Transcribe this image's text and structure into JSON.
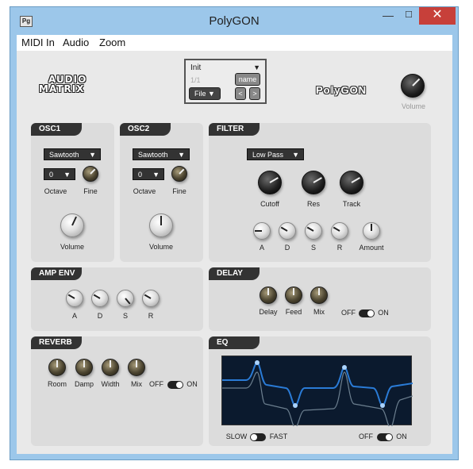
{
  "window": {
    "title": "PolyGON",
    "icon_label": "Pg",
    "minimize": "—",
    "maximize": "☐",
    "close": "✕"
  },
  "menu": {
    "items": [
      "MIDI In",
      "Audio",
      "Zoom"
    ]
  },
  "header": {
    "logo_line1": "AUDIO",
    "logo_line2": "MATRIX",
    "product_logo": "PolyGON",
    "preset": {
      "name": "Init",
      "count": "1/1",
      "file_label": "File",
      "name_button": "name",
      "prev": "<",
      "next": ">"
    },
    "volume_label": "Volume"
  },
  "osc1": {
    "title": "OSC1",
    "waveform": "Sawtooth",
    "octave_value": "0",
    "octave_label": "Octave",
    "fine_label": "Fine",
    "volume_label": "Volume"
  },
  "osc2": {
    "title": "OSC2",
    "waveform": "Sawtooth",
    "octave_value": "0",
    "octave_label": "Octave",
    "fine_label": "Fine",
    "volume_label": "Volume"
  },
  "filter": {
    "title": "FILTER",
    "type": "Low Pass",
    "cutoff": "Cutoff",
    "res": "Res",
    "track": "Track",
    "a": "A",
    "d": "D",
    "s": "S",
    "r": "R",
    "amount": "Amount"
  },
  "amp_env": {
    "title": "AMP ENV",
    "a": "A",
    "d": "D",
    "s": "S",
    "r": "R"
  },
  "delay": {
    "title": "DELAY",
    "delay": "Delay",
    "feed": "Feed",
    "mix": "Mix",
    "off": "OFF",
    "on": "ON"
  },
  "reverb": {
    "title": "REVERB",
    "room": "Room",
    "damp": "Damp",
    "width": "Width",
    "mix": "Mix",
    "off": "OFF",
    "on": "ON"
  },
  "eq": {
    "title": "EQ",
    "slow": "SLOW",
    "fast": "FAST",
    "off": "OFF",
    "on": "ON"
  },
  "colors": {
    "panel_head": "#333333",
    "eq_bg": "#0b1a2e",
    "eq_curve": "#2a7bd6",
    "close": "#c7403a"
  }
}
